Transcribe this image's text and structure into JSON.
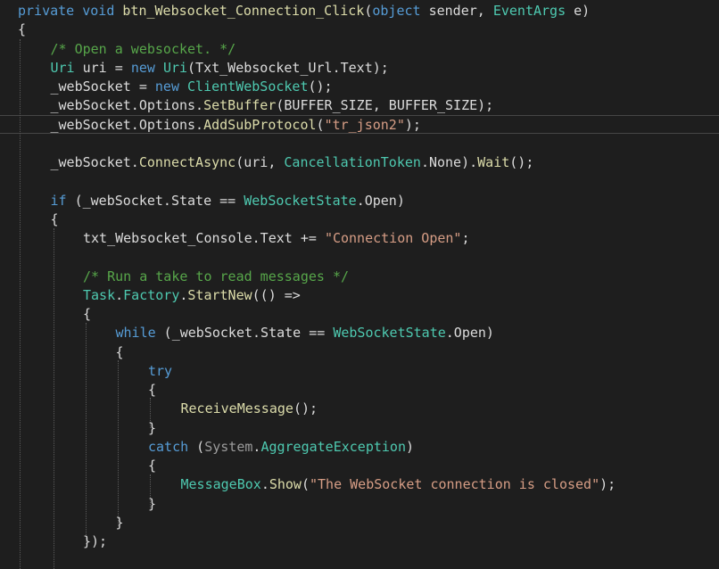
{
  "editor": {
    "lines": [
      {
        "indent": 0,
        "tokens": [
          {
            "t": "private",
            "c": "kw"
          },
          {
            "t": " ",
            "c": "tx"
          },
          {
            "t": "void",
            "c": "kw"
          },
          {
            "t": " ",
            "c": "tx"
          },
          {
            "t": "btn_Websocket_Connection_Click",
            "c": "fn"
          },
          {
            "t": "(",
            "c": "tx"
          },
          {
            "t": "object",
            "c": "kw"
          },
          {
            "t": " sender, ",
            "c": "tx"
          },
          {
            "t": "EventArgs",
            "c": "ty"
          },
          {
            "t": " e)",
            "c": "tx"
          }
        ]
      },
      {
        "indent": 0,
        "tokens": [
          {
            "t": "{",
            "c": "tx"
          }
        ]
      },
      {
        "indent": 1,
        "tokens": [
          {
            "t": "/* Open a websocket. */",
            "c": "cm"
          }
        ]
      },
      {
        "indent": 1,
        "tokens": [
          {
            "t": "Uri",
            "c": "ty"
          },
          {
            "t": " uri = ",
            "c": "tx"
          },
          {
            "t": "new",
            "c": "kw"
          },
          {
            "t": " ",
            "c": "tx"
          },
          {
            "t": "Uri",
            "c": "ty"
          },
          {
            "t": "(Txt_Websocket_Url.Text);",
            "c": "tx"
          }
        ]
      },
      {
        "indent": 1,
        "tokens": [
          {
            "t": "_webSocket = ",
            "c": "tx"
          },
          {
            "t": "new",
            "c": "kw"
          },
          {
            "t": " ",
            "c": "tx"
          },
          {
            "t": "ClientWebSocket",
            "c": "ty"
          },
          {
            "t": "();",
            "c": "tx"
          }
        ]
      },
      {
        "indent": 1,
        "tokens": [
          {
            "t": "_webSocket.Options.",
            "c": "tx"
          },
          {
            "t": "SetBuffer",
            "c": "fn"
          },
          {
            "t": "(BUFFER_SIZE, BUFFER_SIZE);",
            "c": "tx"
          }
        ]
      },
      {
        "indent": 1,
        "tokens": [
          {
            "t": "_webSocket.Options.",
            "c": "tx"
          },
          {
            "t": "AddSubProtocol",
            "c": "fn"
          },
          {
            "t": "(",
            "c": "tx"
          },
          {
            "t": "\"tr_json2\"",
            "c": "str"
          },
          {
            "t": ");",
            "c": "tx"
          }
        ]
      },
      {
        "indent": 0,
        "tokens": []
      },
      {
        "indent": 1,
        "tokens": [
          {
            "t": "_webSocket.",
            "c": "tx"
          },
          {
            "t": "ConnectAsync",
            "c": "fn"
          },
          {
            "t": "(uri, ",
            "c": "tx"
          },
          {
            "t": "CancellationToken",
            "c": "ty"
          },
          {
            "t": ".None).",
            "c": "tx"
          },
          {
            "t": "Wait",
            "c": "fn"
          },
          {
            "t": "();",
            "c": "tx"
          }
        ]
      },
      {
        "indent": 0,
        "tokens": []
      },
      {
        "indent": 1,
        "tokens": [
          {
            "t": "if",
            "c": "kw"
          },
          {
            "t": " (_webSocket.State == ",
            "c": "tx"
          },
          {
            "t": "WebSocketState",
            "c": "ty"
          },
          {
            "t": ".Open)",
            "c": "tx"
          }
        ]
      },
      {
        "indent": 1,
        "tokens": [
          {
            "t": "{",
            "c": "tx"
          }
        ]
      },
      {
        "indent": 2,
        "tokens": [
          {
            "t": "txt_Websocket_Console.Text += ",
            "c": "tx"
          },
          {
            "t": "\"Connection Open\"",
            "c": "str"
          },
          {
            "t": ";",
            "c": "tx"
          }
        ]
      },
      {
        "indent": 0,
        "tokens": []
      },
      {
        "indent": 2,
        "tokens": [
          {
            "t": "/* Run a take to read messages */",
            "c": "cm"
          }
        ]
      },
      {
        "indent": 2,
        "tokens": [
          {
            "t": "Task",
            "c": "ty"
          },
          {
            "t": ".",
            "c": "tx"
          },
          {
            "t": "Factory",
            "c": "ty"
          },
          {
            "t": ".",
            "c": "tx"
          },
          {
            "t": "StartNew",
            "c": "fn"
          },
          {
            "t": "(() =>",
            "c": "tx"
          }
        ]
      },
      {
        "indent": 2,
        "tokens": [
          {
            "t": "{",
            "c": "tx"
          }
        ]
      },
      {
        "indent": 3,
        "tokens": [
          {
            "t": "while",
            "c": "kw"
          },
          {
            "t": " (_webSocket.State == ",
            "c": "tx"
          },
          {
            "t": "WebSocketState",
            "c": "ty"
          },
          {
            "t": ".Open)",
            "c": "tx"
          }
        ]
      },
      {
        "indent": 3,
        "tokens": [
          {
            "t": "{",
            "c": "tx"
          }
        ]
      },
      {
        "indent": 4,
        "tokens": [
          {
            "t": "try",
            "c": "kw"
          }
        ]
      },
      {
        "indent": 4,
        "tokens": [
          {
            "t": "{",
            "c": "tx"
          }
        ]
      },
      {
        "indent": 5,
        "tokens": [
          {
            "t": "ReceiveMessage",
            "c": "fn"
          },
          {
            "t": "();",
            "c": "tx"
          }
        ]
      },
      {
        "indent": 4,
        "tokens": [
          {
            "t": "}",
            "c": "tx"
          }
        ]
      },
      {
        "indent": 4,
        "tokens": [
          {
            "t": "catch",
            "c": "kw"
          },
          {
            "t": " (",
            "c": "tx"
          },
          {
            "t": "System",
            "c": "gu"
          },
          {
            "t": ".",
            "c": "tx"
          },
          {
            "t": "AggregateException",
            "c": "ty"
          },
          {
            "t": ")",
            "c": "tx"
          }
        ]
      },
      {
        "indent": 4,
        "tokens": [
          {
            "t": "{",
            "c": "tx"
          }
        ]
      },
      {
        "indent": 5,
        "tokens": [
          {
            "t": "MessageBox",
            "c": "ty"
          },
          {
            "t": ".",
            "c": "tx"
          },
          {
            "t": "Show",
            "c": "fn"
          },
          {
            "t": "(",
            "c": "tx"
          },
          {
            "t": "\"The WebSocket connection is closed\"",
            "c": "str"
          },
          {
            "t": ");",
            "c": "tx"
          }
        ]
      },
      {
        "indent": 4,
        "tokens": [
          {
            "t": "}",
            "c": "tx"
          }
        ]
      },
      {
        "indent": 3,
        "tokens": [
          {
            "t": "}",
            "c": "tx"
          }
        ]
      },
      {
        "indent": 2,
        "tokens": [
          {
            "t": "});",
            "c": "tx"
          }
        ]
      }
    ],
    "colors": {
      "background": "#1e1e1e",
      "keyword": "#569cd6",
      "type": "#4ec9b0",
      "method": "#dcdcaa",
      "string": "#d69d85",
      "comment": "#57a64a",
      "plain": "#dcdcdc"
    }
  }
}
